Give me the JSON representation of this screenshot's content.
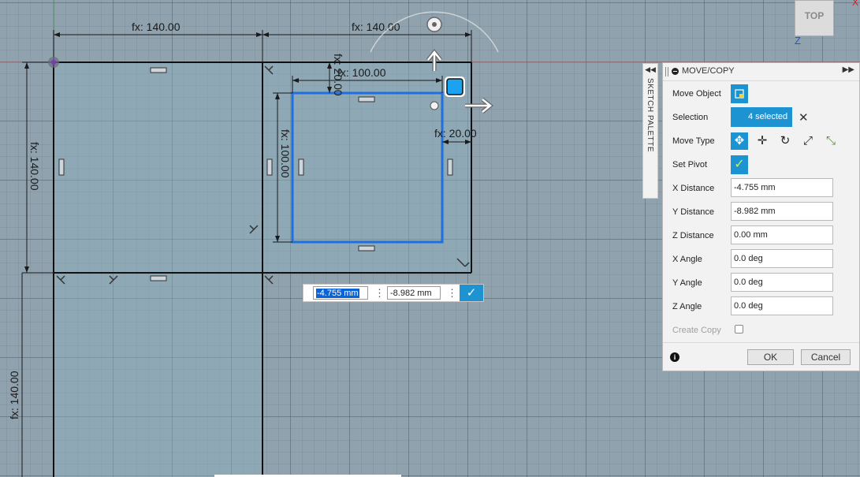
{
  "sketch": {
    "dim_top_left": "fx: 140.00",
    "dim_top_right": "fx: 140.00",
    "dim_left_top": "fx: 140.00",
    "dim_left_bottom": "fx: 140.00",
    "dim_inner_width": "fx: 100.00",
    "dim_inner_height": "fx: 100.00",
    "dim_offset_top": "fx: 20.00",
    "dim_offset_right": "fx: 20.00"
  },
  "inline_input": {
    "x_value": "-4.755 mm",
    "y_value": "-8.982 mm"
  },
  "sketch_palette": {
    "label": "SKETCH PALETTE"
  },
  "dialog": {
    "title": "MOVE/COPY",
    "move_object_label": "Move Object",
    "selection_label": "Selection",
    "selection_value": "4 selected",
    "move_type_label": "Move Type",
    "set_pivot_label": "Set Pivot",
    "x_distance_label": "X Distance",
    "x_distance_value": "-4.755 mm",
    "y_distance_label": "Y Distance",
    "y_distance_value": "-8.982 mm",
    "z_distance_label": "Z Distance",
    "z_distance_value": "0.00 mm",
    "x_angle_label": "X Angle",
    "x_angle_value": "0.0 deg",
    "y_angle_label": "Y Angle",
    "y_angle_value": "0.0 deg",
    "z_angle_label": "Z Angle",
    "z_angle_value": "0.0 deg",
    "create_copy_label": "Create Copy",
    "create_copy_checked": false,
    "ok_label": "OK",
    "cancel_label": "Cancel"
  },
  "viewcube": {
    "face": "TOP",
    "z_axis": "Z",
    "x_axis": "X"
  },
  "colors": {
    "accent": "#1e93d2",
    "selection_blue": "#1e6fe0",
    "canvas_bg": "#8fa2ad"
  }
}
